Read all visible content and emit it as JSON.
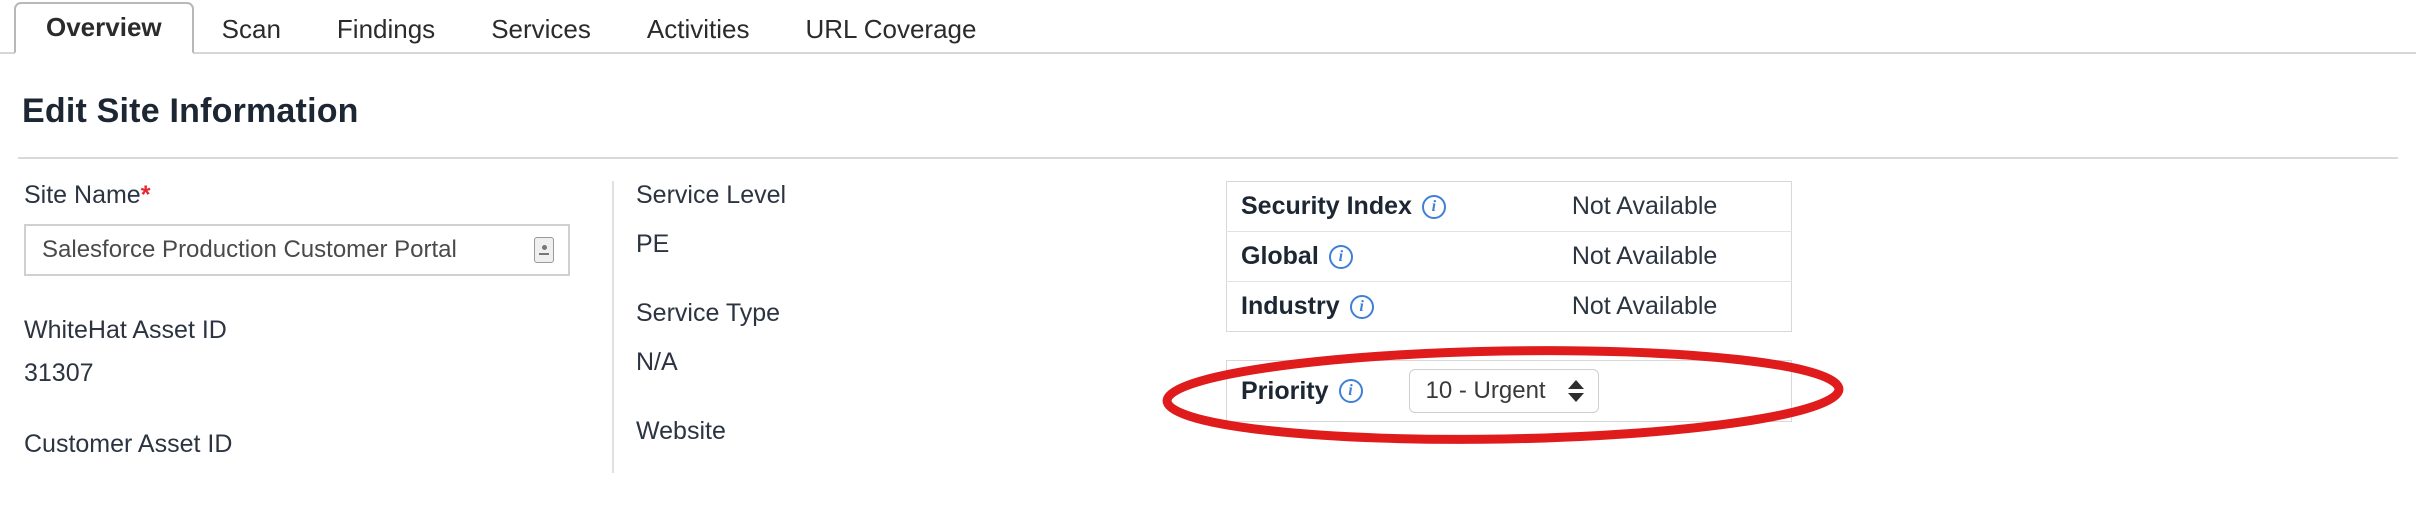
{
  "tabs": [
    {
      "label": "Overview",
      "active": true
    },
    {
      "label": "Scan",
      "active": false
    },
    {
      "label": "Findings",
      "active": false
    },
    {
      "label": "Services",
      "active": false
    },
    {
      "label": "Activities",
      "active": false
    },
    {
      "label": "URL Coverage",
      "active": false
    }
  ],
  "page_title": "Edit Site Information",
  "left_column": {
    "site_name": {
      "label": "Site Name",
      "required_marker": "*",
      "value": "Salesforce Production Customer Portal",
      "placeholder": "Site Name",
      "trailing_icon": "resize-handle-icon"
    },
    "whitehat_asset_id": {
      "label": "WhiteHat Asset ID",
      "value": "31307"
    },
    "customer_asset_id": {
      "label": "Customer Asset ID"
    }
  },
  "middle_column": {
    "service_level": {
      "label": "Service Level",
      "value": "PE"
    },
    "service_type": {
      "label": "Service Type",
      "value": "N/A"
    },
    "website": {
      "label": "Website"
    }
  },
  "right_column": {
    "metrics": [
      {
        "label": "Security Index",
        "info_icon": "info-circle-icon",
        "value": "Not Available"
      },
      {
        "label": "Global",
        "info_icon": "info-circle-icon",
        "value": "Not Available"
      },
      {
        "label": "Industry",
        "info_icon": "info-circle-icon",
        "value": "Not Available"
      }
    ],
    "priority": {
      "label": "Priority",
      "info_icon": "info-circle-icon",
      "selected_value": "10 - Urgent",
      "options": [
        "10 - Urgent"
      ]
    },
    "annotation": {
      "shape": "ellipse",
      "color": "#e01b1b"
    }
  },
  "colors": {
    "accent_blue": "#3f7fd6",
    "required_red": "#e8262d",
    "annotation_red": "#e01b1b",
    "text_dark": "#1d2733",
    "border_grey": "#d8d8d8"
  }
}
